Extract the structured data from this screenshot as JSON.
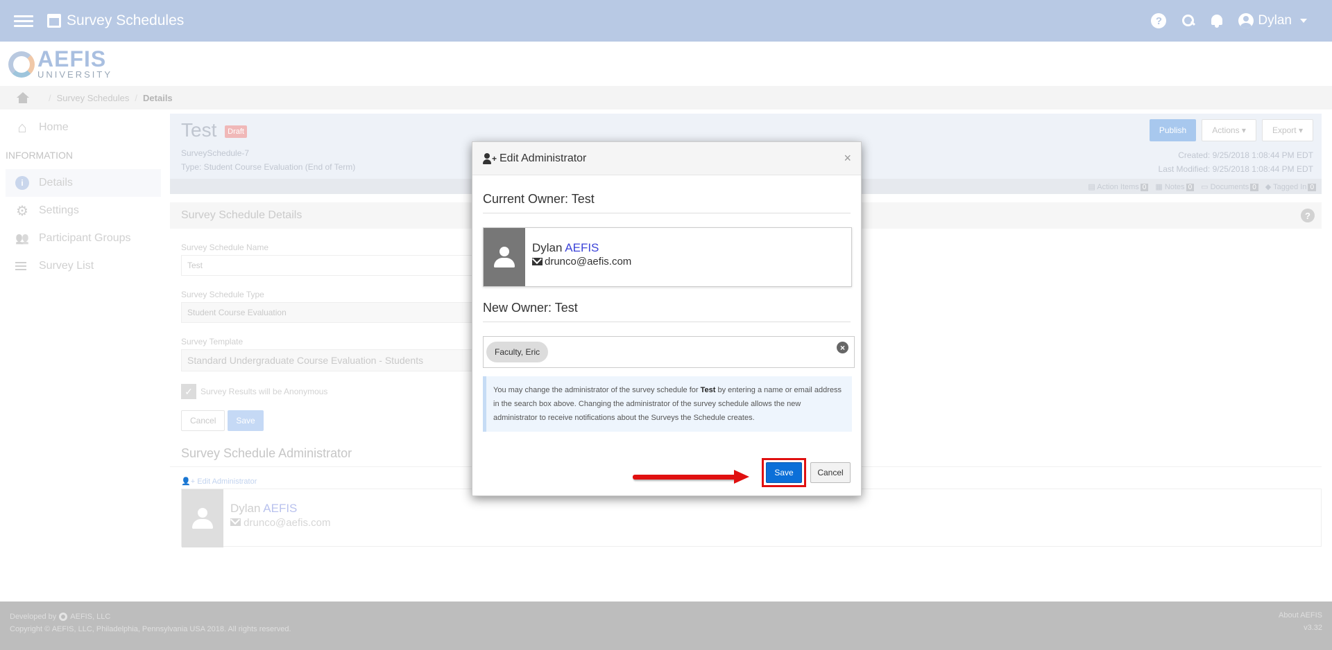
{
  "topbar": {
    "title": "Survey Schedules",
    "user": "Dylan"
  },
  "logo": {
    "name": "AEFIS",
    "sub": "UNIVERSITY"
  },
  "breadcrumb": {
    "items": [
      "Survey Schedules",
      "Details"
    ]
  },
  "sidebar": {
    "home": "Home",
    "section": "INFORMATION",
    "items": [
      "Details",
      "Settings",
      "Participant Groups",
      "Survey List"
    ]
  },
  "header": {
    "name": "Test",
    "badge": "Draft",
    "id": "SurveySchedule-7",
    "type": "Type: Student Course Evaluation (End of Term)",
    "buttons": {
      "publish": "Publish",
      "actions": "Actions",
      "export": "Export"
    },
    "created": "Created: 9/25/2018 1:08:44 PM EDT",
    "modified": "Last Modified: 9/25/2018 1:08:44 PM EDT",
    "counters": [
      {
        "label": "Action Items",
        "count": "0"
      },
      {
        "label": "Notes",
        "count": "0"
      },
      {
        "label": "Documents",
        "count": "0"
      },
      {
        "label": "Tagged In",
        "count": "0"
      }
    ]
  },
  "details": {
    "section_title": "Survey Schedule Details",
    "name_label": "Survey Schedule Name",
    "name_value": "Test",
    "type_label": "Survey Schedule Type",
    "type_value": "Student Course Evaluation",
    "template_label": "Survey Template",
    "template_value": "Standard Undergraduate Course Evaluation - Students",
    "anonymous_label": "Survey Results will be Anonymous",
    "cancel": "Cancel",
    "save": "Save"
  },
  "administrator": {
    "title": "Survey Schedule Administrator",
    "edit_link": "Edit Administrator",
    "first": "Dylan",
    "last": "AEFIS",
    "email": "drunco@aefis.com"
  },
  "modal": {
    "title": "Edit Administrator",
    "current_owner": "Current Owner: Test",
    "owner_first": "Dylan",
    "owner_last": "AEFIS",
    "owner_email": "drunco@aefis.com",
    "new_owner": "New Owner: Test",
    "selected": "Faculty, Eric",
    "note_before": "You may change the administrator of the survey schedule for ",
    "note_bold": "Test",
    "note_after": " by entering a name or email address in the search box above. Changing the administrator of the survey schedule allows the new administrator to receive notifications about the Surveys the Schedule creates.",
    "save": "Save",
    "cancel": "Cancel"
  },
  "footer": {
    "developed": "Developed by",
    "company": "AEFIS, LLC",
    "copyright": "Copyright © AEFIS, LLC, Philadelphia, Pennsylvania USA 2018. All rights reserved.",
    "about": "About AEFIS",
    "version": "v3.32"
  },
  "colors": {
    "topbar": "#b8c9e4",
    "primary": "#0b6fd8",
    "highlight": "#e01010"
  }
}
